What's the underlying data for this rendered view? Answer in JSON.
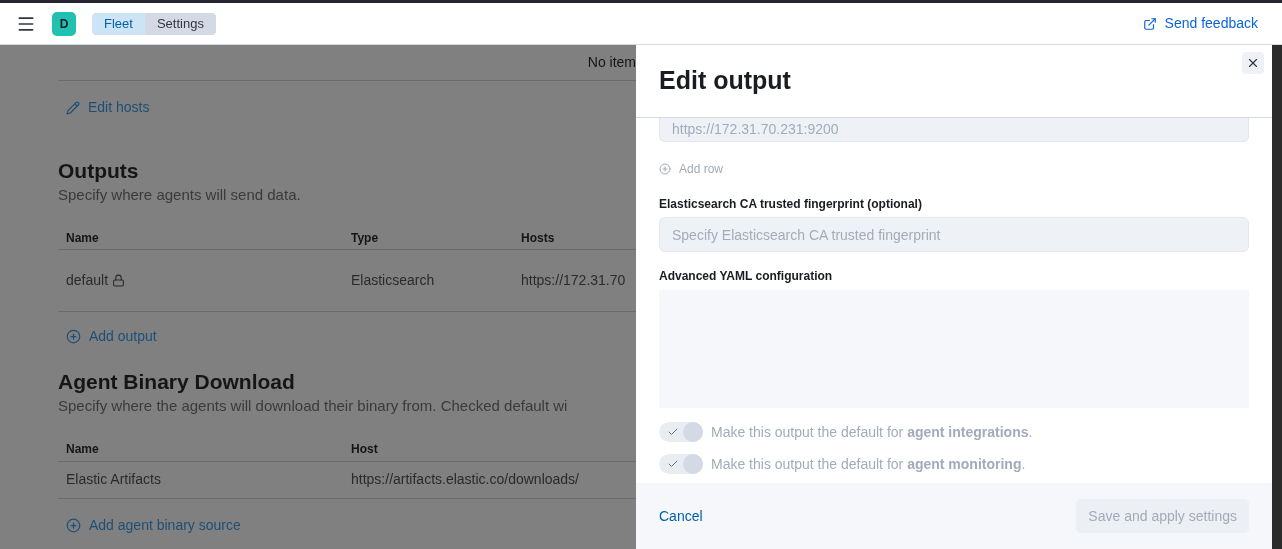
{
  "header": {
    "avatar": "D",
    "breadcrumbs": [
      {
        "label": "Fleet",
        "selected": false
      },
      {
        "label": "Settings",
        "selected": true
      }
    ],
    "feedback_link": "Send feedback"
  },
  "page": {
    "no_items_text": "No item",
    "edit_hosts_link": "Edit hosts",
    "outputs": {
      "title": "Outputs",
      "description": "Specify where agents will send data.",
      "columns": [
        "Name",
        "Type",
        "Hosts"
      ],
      "rows": [
        {
          "name": "default",
          "locked": true,
          "type": "Elasticsearch",
          "hosts": "https://172.31.70"
        }
      ],
      "add_link": "Add output"
    },
    "agent_binary": {
      "title": "Agent Binary Download",
      "description": "Specify where the agents will download their binary from. Checked default wi",
      "columns": [
        "Name",
        "Host"
      ],
      "rows": [
        {
          "name": "Elastic Artifacts",
          "host": "https://artifacts.elastic.co/downloads/"
        }
      ],
      "add_link": "Add agent binary source"
    }
  },
  "flyout": {
    "title": "Edit output",
    "host_value": "https://172.31.70.231:9200",
    "add_row": {
      "label": "Add row",
      "disabled": true
    },
    "fingerprint": {
      "label": "Elasticsearch CA trusted fingerprint (optional)",
      "placeholder": "Specify Elasticsearch CA trusted fingerprint"
    },
    "yaml": {
      "label": "Advanced YAML configuration"
    },
    "toggles": [
      {
        "label": "Make this output the default for **agent integrations**.",
        "checked": true,
        "disabled": true
      },
      {
        "label": "Make this output the default for **agent monitoring**.",
        "checked": true,
        "disabled": true
      }
    ],
    "cancel": "Cancel",
    "save": {
      "label": "Save and apply settings",
      "disabled": true
    }
  }
}
